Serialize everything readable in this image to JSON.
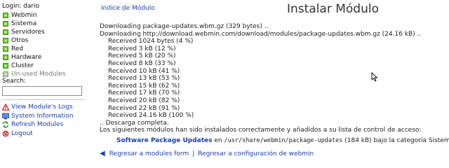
{
  "sidebar": {
    "login": "Login: dario",
    "menu": [
      {
        "label": "Webmin",
        "unused": false
      },
      {
        "label": "Sistema",
        "unused": false
      },
      {
        "label": "Servidores",
        "unused": false
      },
      {
        "label": "Otros",
        "unused": false
      },
      {
        "label": "Red",
        "unused": false
      },
      {
        "label": "Hardware",
        "unused": false
      },
      {
        "label": "Cluster",
        "unused": false
      },
      {
        "label": "Un-used Modules",
        "unused": true
      }
    ],
    "search_label": "Search:",
    "search_value": "",
    "links": [
      {
        "label": "View Module's Logs",
        "icon": "warning-icon"
      },
      {
        "label": "System Information",
        "icon": "info-icon"
      },
      {
        "label": "Refresh Modules",
        "icon": "refresh-icon"
      },
      {
        "label": "Logout",
        "icon": "logout-icon"
      }
    ]
  },
  "main": {
    "index_link": "Indice de Módulo",
    "title": "Instalar Módulo",
    "log_lines": [
      {
        "text": "Downloading package-updates.wbm.gz (329 bytes) ..",
        "indent": false
      },
      {
        "text": "Downloading http://download.webmin.com/download/modules/package-updates.wbm.gz (24.16 kB) ..",
        "indent": false
      },
      {
        "text": "Received 1024 bytes (4 %)",
        "indent": true
      },
      {
        "text": "Received 3 kB (12 %)",
        "indent": true
      },
      {
        "text": "Received 5 kB (20 %)",
        "indent": true
      },
      {
        "text": "Received 8 kB (33 %)",
        "indent": true
      },
      {
        "text": "Received 10 kB (41 %)",
        "indent": true
      },
      {
        "text": "Received 13 kB (53 %)",
        "indent": true
      },
      {
        "text": "Received 15 kB (62 %)",
        "indent": true
      },
      {
        "text": "Received 17 kB (70 %)",
        "indent": true
      },
      {
        "text": "Received 20 kB (82 %)",
        "indent": true
      },
      {
        "text": "Received 22 kB (91 %)",
        "indent": true
      },
      {
        "text": "Received 24.16 kB (100 %)",
        "indent": true
      },
      {
        "text": ".. Descarga completa.",
        "indent": false
      },
      {
        "text": "Los siguientes módulos han sido instalados correctamente y añadidos a su lista de control de acceso:",
        "indent": false
      }
    ],
    "result": {
      "package": "Software Package Updates",
      "text_en": "en",
      "path": "/usr/share/webmin/package-updates",
      "details": "(184 kB) bajo la categoría Sistema"
    },
    "bottom_links": {
      "modules_form": "Regresar a modules form",
      "separator": "|",
      "config": "Regresar a configuración de webmin"
    }
  }
}
